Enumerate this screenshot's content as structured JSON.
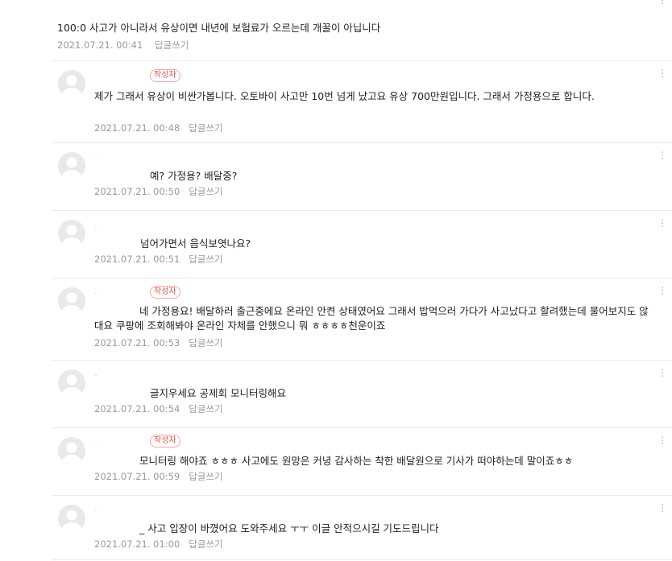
{
  "top_comment": {
    "text": "100:0 사고가 아니라서 유상이면 내년에 보험료가 오르는데 개꿀이 아닙니다",
    "date": "2021.07.21. 00:41",
    "reply_label": "답글쓰기"
  },
  "author_badge": "작성자",
  "replies": [
    {
      "is_author": true,
      "text": "제가 그래서 유상이 비싼가봅니다. 오토바이 사고만 10번 넘게 났고요 유상 700만원입니다. 그래서 가정용으로 합니다.",
      "date": "2021.07.21. 00:48",
      "reply_label": "답글쓰기"
    },
    {
      "is_author": false,
      "text": "예? 가정용? 배달중?",
      "date": "2021.07.21. 00:50",
      "reply_label": "답글쓰기"
    },
    {
      "is_author": false,
      "text": "넘어가면서 음식보엿나요?",
      "date": "2021.07.21. 00:51",
      "reply_label": "답글쓰기"
    },
    {
      "is_author": true,
      "text": "네 가정용요! 배달하러 출근중에요 온라인 안켠 상태였어요 그래서 밥먹으러 가다가 사고났다고 할려했는데 물어보지도 않대요 쿠팡에 조회해봐야 온라인 자체를 안했으니 뭐 ㅎㅎㅎㅎ천운이죠",
      "date": "2021.07.21. 00:53",
      "reply_label": "답글쓰기"
    },
    {
      "is_author": false,
      "text": "글지우세요 공제회 모니터링해요",
      "date": "2021.07.21. 00:54",
      "reply_label": "답글쓰기"
    },
    {
      "is_author": true,
      "text": "모니터링 해야죠 ㅎㅎㅎ 사고에도 원망은 커녕 감사하는 착한 배달원으로 기사가 떠야하는데 말이죠ㅎㅎ",
      "date": "2021.07.21. 00:59",
      "reply_label": "답글쓰기"
    },
    {
      "is_author": false,
      "text": "_ 사고 입장이 바꼈어요 도와주세요 ㅜㅜ 이글 안적으시길 기도드립니다",
      "date": "2021.07.21. 01:00",
      "reply_label": "답글쓰기"
    }
  ]
}
